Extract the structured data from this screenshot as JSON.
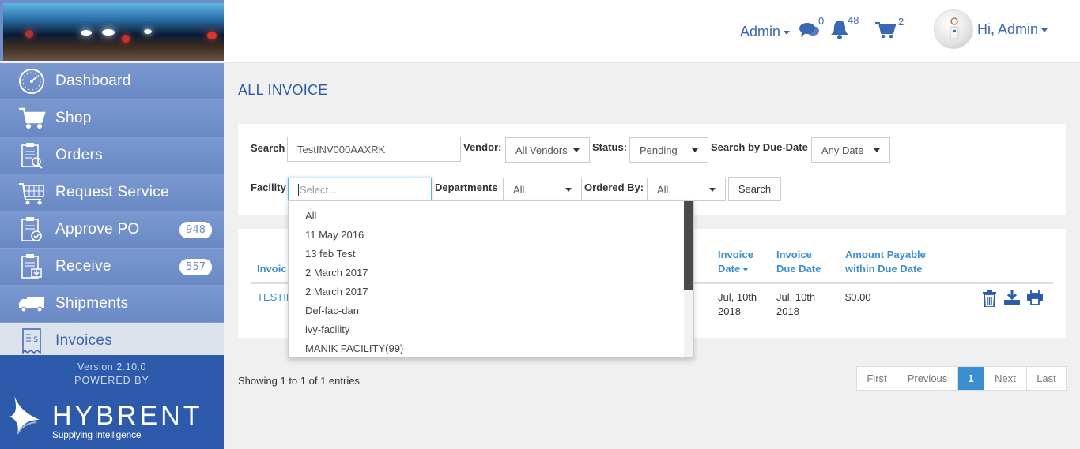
{
  "header": {
    "admin_label": "Admin",
    "messages_count": "0",
    "notifications_count": "48",
    "cart_count": "2",
    "greeting": "Hi, Admin"
  },
  "sidebar": {
    "items": [
      {
        "label": "Dashboard"
      },
      {
        "label": "Shop"
      },
      {
        "label": "Orders"
      },
      {
        "label": "Request Service"
      },
      {
        "label": "Approve PO",
        "badge": "948"
      },
      {
        "label": "Receive",
        "badge": "557"
      },
      {
        "label": "Shipments"
      },
      {
        "label": "Invoices"
      }
    ],
    "version": "Version 2.10.0",
    "powered_by": "POWERED BY",
    "brand_name": "HYBRENT",
    "brand_tagline": "Supplying Intelligence"
  },
  "page": {
    "title": "ALL INVOICE"
  },
  "filters": {
    "search_label": "Search",
    "search_value": "TestINV000AAXRK",
    "vendor_label": "Vendor:",
    "vendor_value": "All Vendors",
    "status_label": "Status:",
    "status_value": "Pending",
    "due_date_label": "Search by Due-Date",
    "due_date_value": "Any Date",
    "facility_label": "Facility",
    "facility_placeholder": "Select...",
    "departments_label": "Departments",
    "departments_value": "All",
    "ordered_by_label": "Ordered By:",
    "ordered_by_value": "All",
    "search_button": "Search"
  },
  "facility_options": [
    "All",
    "11 May 2016",
    "13 feb Test",
    "2 March 2017",
    "2 March 2017",
    "Def-fac-dan",
    "ivy-facility",
    "MANIK FACILITY(99)"
  ],
  "table": {
    "headers": {
      "invoice_partial": "Invoic",
      "invoice_date": "Invoice\nDate",
      "invoice_due_date": "Invoice\nDue Date",
      "amount_payable": "Amount Payable\nwithin Due Date"
    },
    "row": {
      "invoice_partial": "TESTIN",
      "invoice_date": "Jul, 10th\n2018",
      "due_date": "Jul, 10th\n2018",
      "amount": "$0.00"
    }
  },
  "pagination": {
    "showing": "Showing 1 to 1 of 1 entries",
    "first": "First",
    "previous": "Previous",
    "current": "1",
    "next": "Next",
    "last": "Last"
  },
  "colors": {
    "primary": "#3b67b3",
    "link": "#3b8fd1",
    "sidebar": "#6f8ec9",
    "footer": "#2e5aab"
  }
}
